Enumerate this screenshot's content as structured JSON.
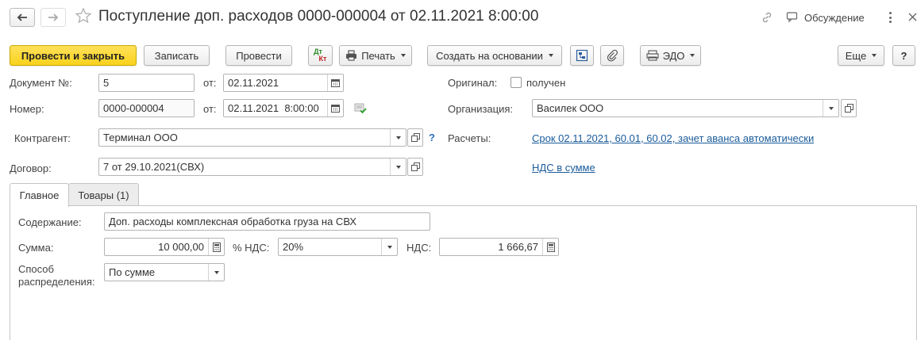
{
  "header": {
    "title": "Поступление доп. расходов 0000-000004 от 02.11.2021 8:00:00",
    "discussion_label": "Обсуждение"
  },
  "toolbar": {
    "post_close": "Провести и закрыть",
    "save": "Записать",
    "post": "Провести",
    "dtkt_top": "Дт",
    "dtkt_bottom": "Кт",
    "print": "Печать",
    "create_based": "Создать на основании",
    "edo": "ЭДО",
    "more": "Еще",
    "help": "?"
  },
  "form": {
    "doc_no_label": "Документ №:",
    "doc_no_value": "5",
    "from_label": "от:",
    "doc_date": "02.11.2021",
    "number_label": "Номер:",
    "number_value": "0000-000004",
    "from_label2": "от:",
    "number_date": "02.11.2021  8:00:00",
    "original_label": "Оригинал:",
    "received_label": "получен",
    "org_label": "Организация:",
    "org_value": "Василек ООО",
    "counterparty_label": "Контрагент:",
    "counterparty_value": "Терминал ООО",
    "help_mark": "?",
    "settlements_label": "Расчеты:",
    "settlements_link": "Срок 02.11.2021, 60.01, 60.02, зачет аванса автоматически",
    "contract_label": "Договор:",
    "contract_value": "7 от 29.10.2021(СВХ)",
    "vat_link": "НДС в сумме"
  },
  "tabs": [
    {
      "label": "Главное",
      "active": true
    },
    {
      "label": "Товары (1)",
      "active": false
    }
  ],
  "main_tab": {
    "content_label": "Содержание:",
    "content_value": "Доп. расходы комплексная обработка груза на СВХ",
    "sum_label": "Сумма:",
    "sum_value": "10 000,00",
    "vat_rate_label": "% НДС:",
    "vat_rate_value": "20%",
    "vat_label": "НДС:",
    "vat_value": "1 666,67",
    "method_label_1": "Способ",
    "method_label_2": "распределения:",
    "method_value": "По сумме"
  },
  "colors": {
    "primary_button": "#f8d21c",
    "link": "#1a5b9a"
  }
}
